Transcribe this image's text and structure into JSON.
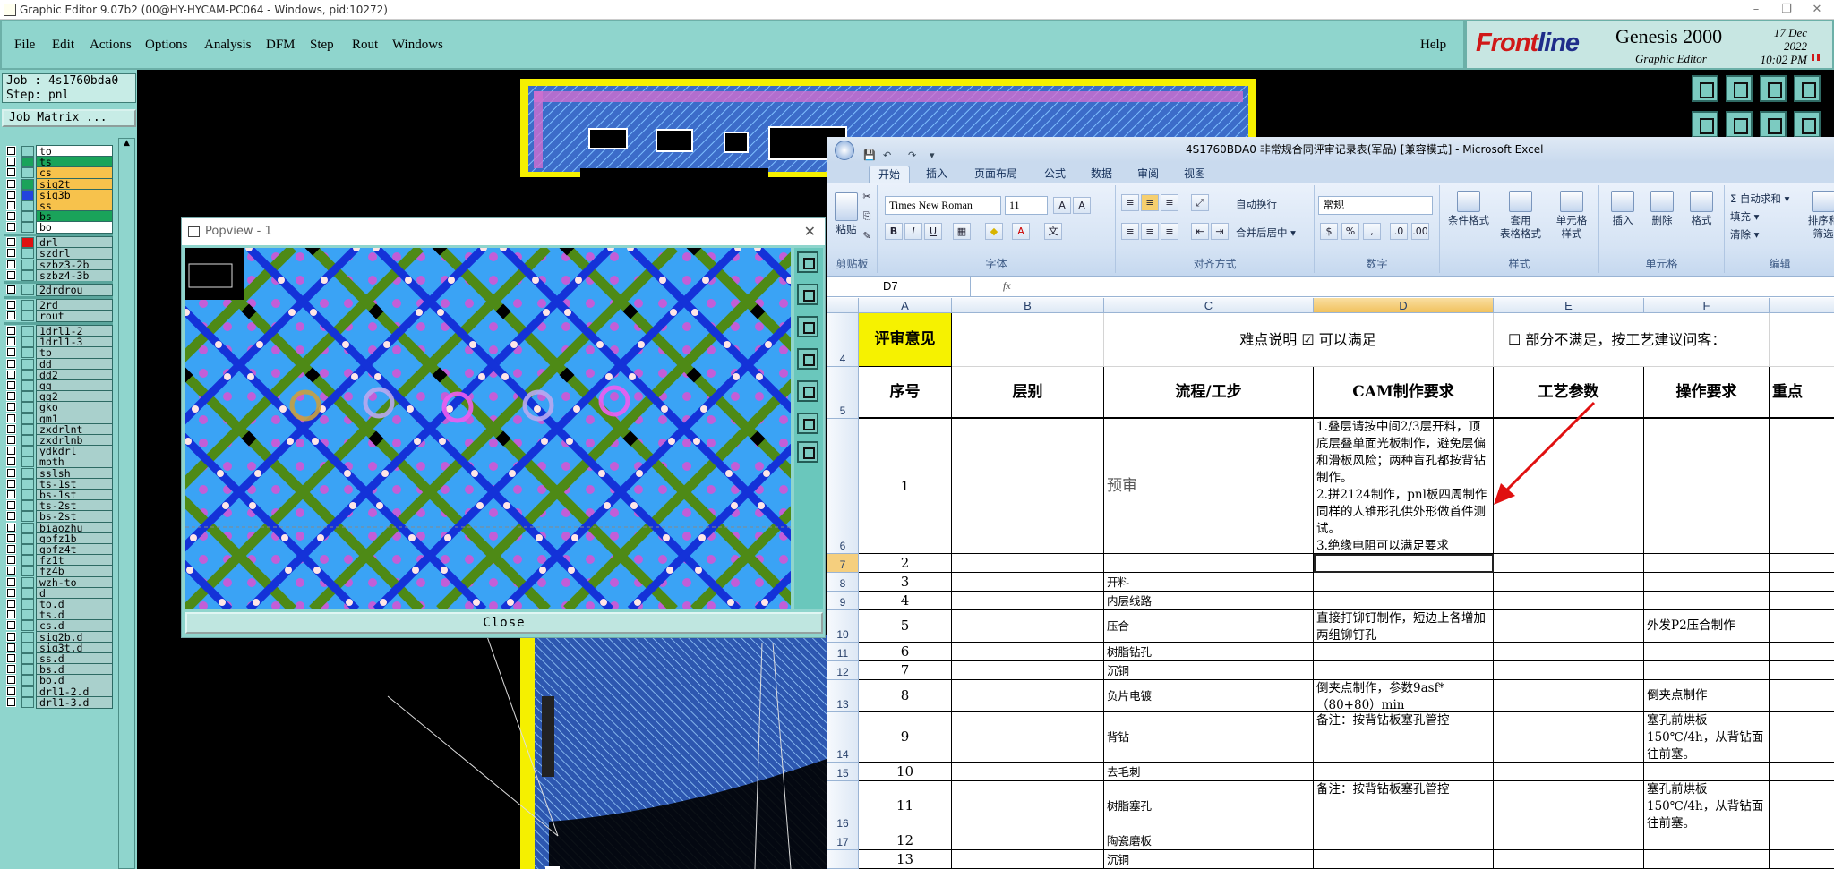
{
  "window": {
    "title": "Graphic Editor 9.07b2 (00@HY-HYCAM-PC064 - Windows, pid:10272)",
    "controls": [
      "–",
      "❐",
      "✕"
    ]
  },
  "menu": [
    "File",
    "Edit",
    "Actions",
    "Options",
    "Analysis",
    "DFM",
    "Step",
    "Rout",
    "Windows"
  ],
  "help": "Help",
  "brand": {
    "logo_a": "Front",
    "logo_b": "line",
    "product": "Genesis 2000",
    "sub": "Graphic Editor",
    "date": "17 Dec 2022",
    "time": "10:02 PM"
  },
  "job": {
    "job_line": "Job : 4s1760bda0",
    "step_line": "Step: pnl",
    "matrix_button": "Job Matrix ..."
  },
  "layers_a": [
    {
      "name": "to",
      "color": "#ffffff"
    },
    {
      "name": "ts",
      "color": "#1aa35a"
    },
    {
      "name": "cs",
      "color": "#f7c24c"
    },
    {
      "name": "sig2t",
      "color": "#f7c24c"
    },
    {
      "name": "sig3b",
      "color": "#f7c24c"
    },
    {
      "name": "ss",
      "color": "#f7c24c"
    },
    {
      "name": "bs",
      "color": "#1aa35a"
    },
    {
      "name": "bo",
      "color": "#ffffff"
    }
  ],
  "layers_a_swatches": [
    "#8fd5cd",
    "#1aa35a",
    "#8fd5cd",
    "#1aa35a",
    "#2244dd",
    "#8fd5cd",
    "#8fd5cd",
    "#8fd5cd"
  ],
  "layers_b": [
    {
      "name": "drl",
      "color": "#a9d0cc"
    },
    {
      "name": "szdrl",
      "color": "#a9d0cc"
    },
    {
      "name": "szbz3-2b",
      "color": "#a9d0cc"
    },
    {
      "name": "szbz4-3b",
      "color": "#a9d0cc"
    }
  ],
  "layers_c": [
    {
      "name": "2drdrou",
      "color": "#a9d0cc"
    }
  ],
  "layers_d": [
    {
      "name": "2rd",
      "color": "#a9d0cc"
    },
    {
      "name": "rout",
      "color": "#a9d0cc"
    }
  ],
  "layers_e": [
    "1drl1-2",
    "1drl1-3",
    "tp",
    "dd",
    "dd2",
    "gg",
    "gg2",
    "gko",
    "gm1",
    "zxdrlnt",
    "zxdrlnb",
    "ydkdrl",
    "mpth",
    "sslsh",
    "ts-1st",
    "bs-1st",
    "ts-2st",
    "bs-2st",
    "biaozhu",
    "gbfz1b",
    "gbfz4t",
    "fz1t",
    "fz4b",
    "wzh-to",
    "d",
    "to.d",
    "ts.d",
    "cs.d",
    "sig2b.d",
    "sig3t.d",
    "ss.d",
    "bs.d",
    "bo.d",
    "drl1-2.d",
    "drl1-3.d"
  ],
  "popview": {
    "title": "Popview - 1",
    "close_label": "Close",
    "close_x": "✕"
  },
  "excel": {
    "title": "4S1760BDA0  非常规合同评审记录表(军品)  [兼容模式] - Microsoft Excel",
    "tabs": [
      "开始",
      "插入",
      "页面布局",
      "公式",
      "数据",
      "审阅",
      "视图"
    ],
    "clipboard": {
      "paste": "粘贴",
      "label": "剪贴板"
    },
    "font": {
      "name": "Times New Roman",
      "size": "11",
      "label": "字体"
    },
    "align": {
      "wrap": "自动换行",
      "merge": "合并后居中 ▾",
      "label": "对齐方式"
    },
    "number": {
      "format": "常规",
      "label": "数字"
    },
    "styles": {
      "cond": "条件格式",
      "table": "套用\n表格格式",
      "cell": "单元格\n样式",
      "label": "样式"
    },
    "cells": {
      "insert": "插入",
      "delete": "删除",
      "format": "格式",
      "label": "单元格"
    },
    "edit": {
      "autosum": "Σ 自动求和 ▾",
      "fill": "填充 ▾",
      "clear": "清除 ▾",
      "sort": "排序和\n筛选",
      "label": "编辑"
    },
    "name_box": "D7",
    "fx": "fx",
    "columns": [
      "A",
      "B",
      "C",
      "D",
      "E",
      "F"
    ],
    "row4": {
      "a": "评审意见",
      "c": "难点说明 ☑ 可以满足",
      "e": "☐  部分不满足，按工艺建议问客："
    },
    "headers": {
      "seq": "序号",
      "layer": "层别",
      "flow": "流程/工步",
      "cam": "CAM制作要求",
      "param": "工艺参数",
      "op": "操作要求",
      "key": "重点"
    },
    "rows": [
      {
        "rn": "6",
        "seq": "1",
        "flow": "预审",
        "cam": "1.叠层请按中间2/3层开料，顶底层叠单面光板制作，避免层偏和滑板风险；两种盲孔都按背钻制作。\n2.拼2124制作，pnl板四周制作同样的人锥形孔供外形做首件测试。\n3.绝缘电阻可以满足要求",
        "op": ""
      },
      {
        "rn": "7",
        "seq": "2",
        "flow": "",
        "cam": "",
        "op": ""
      },
      {
        "rn": "8",
        "seq": "3",
        "flow": "开料",
        "cam": "",
        "op": ""
      },
      {
        "rn": "9",
        "seq": "4",
        "flow": "内层线路",
        "cam": "",
        "op": ""
      },
      {
        "rn": "10",
        "seq": "5",
        "flow": "压合",
        "cam": "直接打铆钉制作，短边上各增加两组铆钉孔",
        "op": "外发P2压合制作"
      },
      {
        "rn": "11",
        "seq": "6",
        "flow": "树脂钻孔",
        "cam": "",
        "op": ""
      },
      {
        "rn": "12",
        "seq": "7",
        "flow": "沉铜",
        "cam": "",
        "op": ""
      },
      {
        "rn": "13",
        "seq": "8",
        "flow": "负片电镀",
        "cam": "倒夹点制作，参数9asf*（80+80）min",
        "op": "倒夹点制作"
      },
      {
        "rn": "14",
        "seq": "9",
        "flow": "背钻",
        "cam": "备注：按背钻板塞孔管控",
        "op": "塞孔前烘板150℃/4h，从背钻面往前塞。"
      },
      {
        "rn": "15",
        "seq": "10",
        "flow": "去毛刺",
        "cam": "",
        "op": ""
      },
      {
        "rn": "16",
        "seq": "11",
        "flow": "树脂塞孔",
        "cam": "备注：按背钻板塞孔管控",
        "op": "塞孔前烘板150℃/4h，从背钻面往前塞。"
      },
      {
        "rn": "17",
        "seq": "12",
        "flow": "陶瓷磨板",
        "cam": "",
        "op": ""
      },
      {
        "rn": "",
        "seq": "13",
        "flow": "沉铜",
        "cam": "",
        "op": ""
      }
    ],
    "row_labels_top": [
      "4",
      "5"
    ]
  },
  "colors": {
    "teal": "#8fd5cd",
    "pcb_blue": "#3aa3f5",
    "pcb_yellow": "#f5f000",
    "accent_red": "#e01010"
  }
}
